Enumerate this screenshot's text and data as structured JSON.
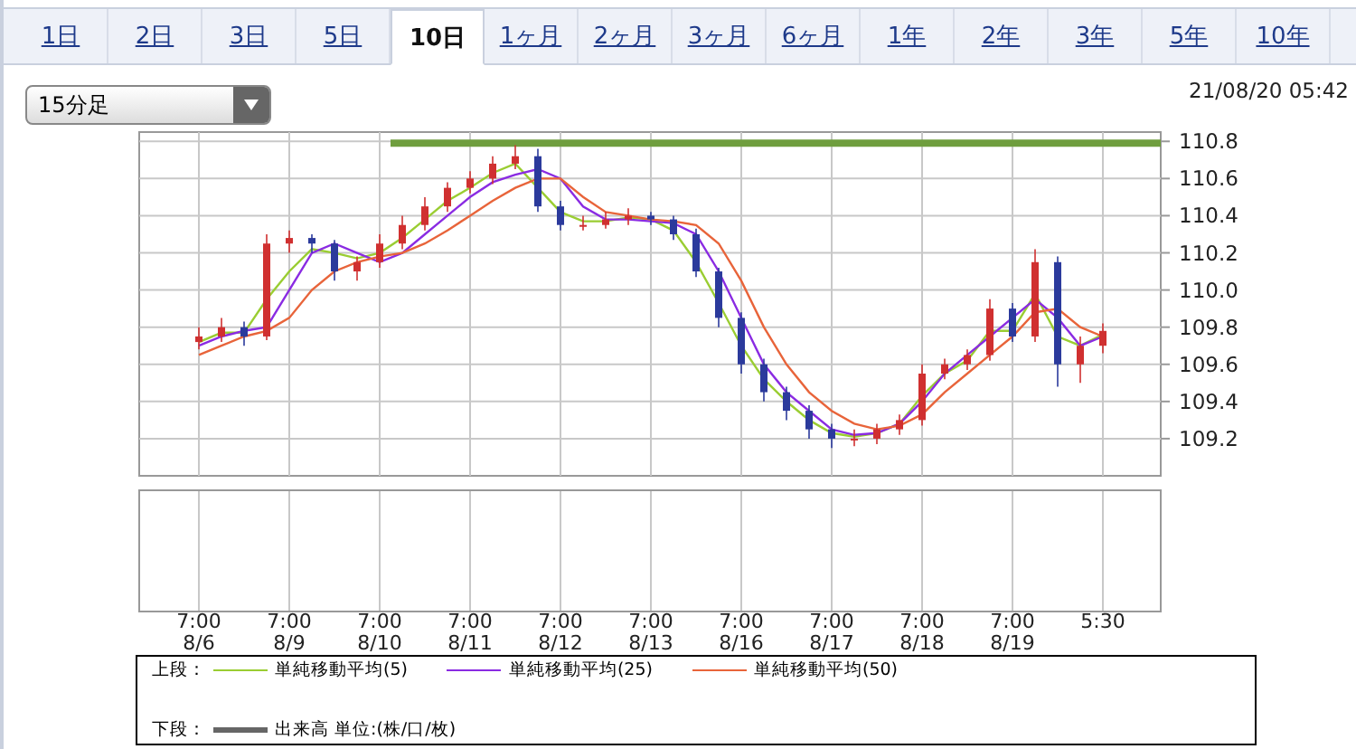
{
  "tabs": [
    {
      "label": "1日",
      "selected": false
    },
    {
      "label": "2日",
      "selected": false
    },
    {
      "label": "3日",
      "selected": false
    },
    {
      "label": "5日",
      "selected": false
    },
    {
      "label": "10日",
      "selected": true
    },
    {
      "label": "1ヶ月",
      "selected": false
    },
    {
      "label": "2ヶ月",
      "selected": false
    },
    {
      "label": "3ヶ月",
      "selected": false
    },
    {
      "label": "6ヶ月",
      "selected": false
    },
    {
      "label": "1年",
      "selected": false
    },
    {
      "label": "2年",
      "selected": false
    },
    {
      "label": "3年",
      "selected": false
    },
    {
      "label": "5年",
      "selected": false
    },
    {
      "label": "10年",
      "selected": false
    }
  ],
  "interval_select": {
    "value": "15分足"
  },
  "timestamp": "21/08/20 05:42",
  "chart_data": {
    "type": "candlestick",
    "grid": true,
    "ylim": [
      109.0,
      110.85
    ],
    "yticks": [
      109.2,
      109.4,
      109.6,
      109.8,
      {
        "value": 110,
        "label": "110.0"
      },
      110.2,
      110.4,
      110.6,
      110.8
    ],
    "categories": [
      "7:00\n8/6",
      null,
      null,
      null,
      "7:00\n8/9",
      null,
      null,
      null,
      "7:00\n8/10",
      null,
      null,
      null,
      "7:00\n8/11",
      null,
      null,
      null,
      "7:00\n8/12",
      null,
      null,
      null,
      "7:00\n8/13",
      null,
      null,
      null,
      "7:00\n8/16",
      null,
      null,
      null,
      "7:00\n8/17",
      null,
      null,
      null,
      "7:00\n8/18",
      null,
      null,
      null,
      "7:00\n8/19",
      null,
      null,
      null,
      "5:30"
    ],
    "ohlc": [
      [
        109.72,
        109.8,
        109.68,
        109.75
      ],
      [
        109.75,
        109.85,
        109.72,
        109.8
      ],
      [
        109.8,
        109.83,
        109.7,
        109.75
      ],
      [
        109.75,
        110.3,
        109.73,
        110.25
      ],
      [
        110.25,
        110.32,
        110.2,
        110.28
      ],
      [
        110.28,
        110.3,
        110.2,
        110.25
      ],
      [
        110.25,
        110.27,
        110.05,
        110.1
      ],
      [
        110.1,
        110.18,
        110.05,
        110.15
      ],
      [
        110.15,
        110.3,
        110.12,
        110.25
      ],
      [
        110.25,
        110.4,
        110.22,
        110.35
      ],
      [
        110.35,
        110.5,
        110.32,
        110.45
      ],
      [
        110.45,
        110.58,
        110.42,
        110.55
      ],
      [
        110.55,
        110.64,
        110.52,
        110.6
      ],
      [
        110.6,
        110.72,
        110.57,
        110.68
      ],
      [
        110.68,
        110.78,
        110.65,
        110.72
      ],
      [
        110.72,
        110.76,
        110.42,
        110.45
      ],
      [
        110.45,
        110.48,
        110.32,
        110.35
      ],
      [
        110.35,
        110.4,
        110.32,
        110.35
      ],
      [
        110.35,
        110.42,
        110.33,
        110.38
      ],
      [
        110.38,
        110.44,
        110.35,
        110.4
      ],
      [
        110.4,
        110.42,
        110.35,
        110.38
      ],
      [
        110.38,
        110.4,
        110.27,
        110.3
      ],
      [
        110.3,
        110.33,
        110.07,
        110.1
      ],
      [
        110.1,
        110.12,
        109.8,
        109.85
      ],
      [
        109.85,
        109.88,
        109.55,
        109.6
      ],
      [
        109.6,
        109.63,
        109.4,
        109.45
      ],
      [
        109.45,
        109.48,
        109.3,
        109.35
      ],
      [
        109.35,
        109.38,
        109.2,
        109.25
      ],
      [
        109.25,
        109.28,
        109.15,
        109.2
      ],
      [
        109.2,
        109.25,
        109.16,
        109.2
      ],
      [
        109.2,
        109.28,
        109.17,
        109.25
      ],
      [
        109.25,
        109.33,
        109.22,
        109.3
      ],
      [
        109.3,
        109.6,
        109.27,
        109.55
      ],
      [
        109.55,
        109.63,
        109.52,
        109.6
      ],
      [
        109.6,
        109.68,
        109.57,
        109.65
      ],
      [
        109.65,
        109.95,
        109.62,
        109.9
      ],
      [
        109.9,
        109.93,
        109.72,
        109.75
      ],
      [
        109.75,
        110.22,
        109.72,
        110.15
      ],
      [
        110.15,
        110.18,
        109.48,
        109.6
      ],
      [
        109.6,
        109.75,
        109.5,
        109.7
      ],
      [
        109.7,
        109.82,
        109.66,
        109.78
      ]
    ],
    "series": [
      {
        "name": "単純移動平均(5)",
        "type": "line",
        "color": "#9acd32",
        "values": [
          109.72,
          109.77,
          109.77,
          109.95,
          110.1,
          110.22,
          110.2,
          110.17,
          110.2,
          110.28,
          110.38,
          110.48,
          110.55,
          110.63,
          110.68,
          110.55,
          110.42,
          110.37,
          110.37,
          110.39,
          110.38,
          110.32,
          110.15,
          109.93,
          109.7,
          109.52,
          109.4,
          109.3,
          109.23,
          109.21,
          109.23,
          109.28,
          109.43,
          109.55,
          109.62,
          109.78,
          109.78,
          109.98,
          109.75,
          109.7,
          109.76
        ]
      },
      {
        "name": "単純移動平均(25)",
        "type": "line",
        "color": "#8a2be2",
        "values": [
          109.7,
          109.75,
          109.78,
          109.8,
          110.0,
          110.2,
          110.25,
          110.2,
          110.15,
          110.2,
          110.3,
          110.4,
          110.5,
          110.58,
          110.62,
          110.65,
          110.6,
          110.45,
          110.38,
          110.38,
          110.37,
          110.36,
          110.3,
          110.1,
          109.85,
          109.6,
          109.45,
          109.35,
          109.25,
          109.22,
          109.23,
          109.28,
          109.4,
          109.55,
          109.65,
          109.75,
          109.85,
          109.95,
          109.85,
          109.7,
          109.75
        ]
      },
      {
        "name": "単純移動平均(50)",
        "type": "line",
        "color": "#e8643a",
        "values": [
          109.65,
          109.7,
          109.75,
          109.78,
          109.85,
          110.0,
          110.1,
          110.15,
          110.18,
          110.2,
          110.25,
          110.32,
          110.4,
          110.48,
          110.55,
          110.6,
          110.6,
          110.5,
          110.42,
          110.4,
          110.38,
          110.37,
          110.35,
          110.25,
          110.05,
          109.8,
          109.6,
          109.45,
          109.35,
          109.28,
          109.25,
          109.27,
          109.33,
          109.45,
          109.55,
          109.65,
          109.75,
          109.88,
          109.9,
          109.8,
          109.75
        ]
      }
    ],
    "ref_lines": [
      {
        "axis": "y",
        "value": 110.79,
        "color": "#6f9e3e"
      }
    ]
  },
  "legend": {
    "upper_label": "上段：",
    "lower_label": "下段：",
    "lower_item": {
      "name": "出来高 単位:(株/口/枚)",
      "color": "#666666"
    }
  }
}
